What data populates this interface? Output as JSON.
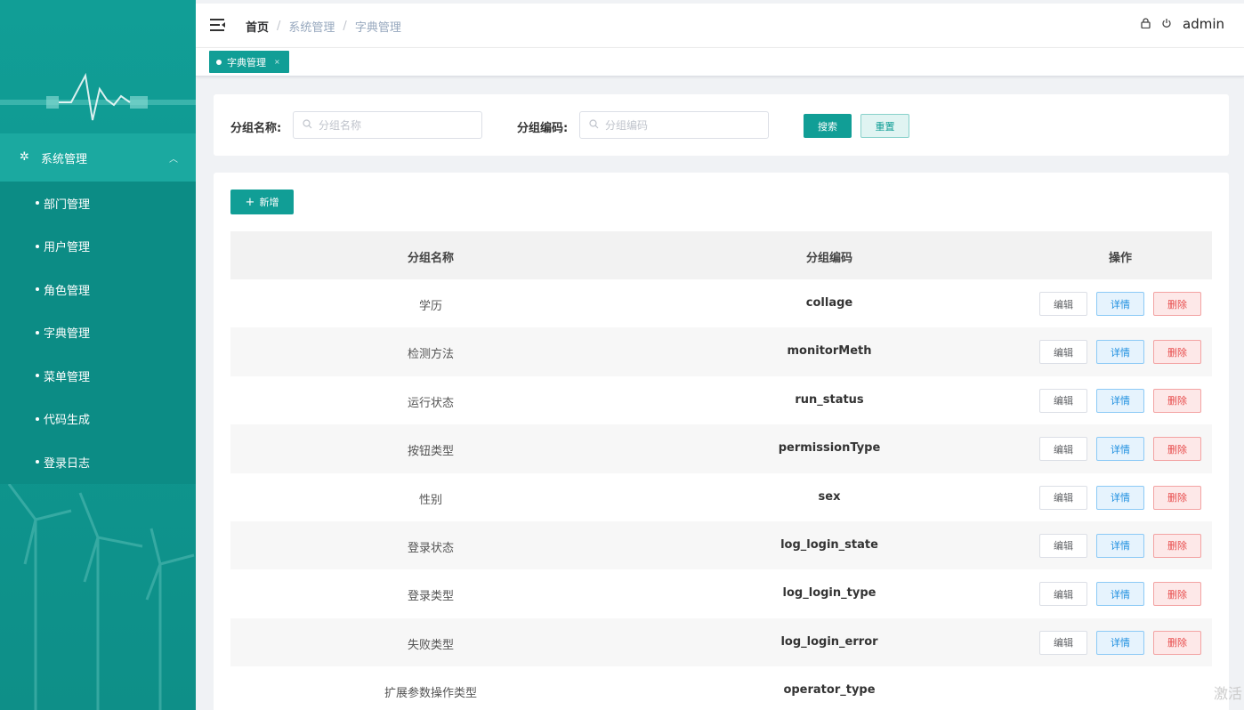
{
  "colors": {
    "primary": "#119e96",
    "sidebar_bg": "#0c8c85",
    "danger": "#e84d4d",
    "info": "#1d8fe0"
  },
  "sidebar": {
    "group": {
      "label": "系统管理",
      "icon": "gear-icon"
    },
    "items": [
      {
        "label": "部门管理"
      },
      {
        "label": "用户管理"
      },
      {
        "label": "角色管理"
      },
      {
        "label": "字典管理"
      },
      {
        "label": "菜单管理"
      },
      {
        "label": "代码生成"
      },
      {
        "label": "登录日志"
      }
    ]
  },
  "header": {
    "breadcrumbs": [
      "首页",
      "系统管理",
      "字典管理"
    ],
    "separator": "/",
    "user": "admin"
  },
  "tags": [
    {
      "label": "字典管理",
      "close": "×"
    }
  ],
  "search": {
    "group_name_label": "分组名称:",
    "group_name_placeholder": "分组名称",
    "group_code_label": "分组编码:",
    "group_code_placeholder": "分组编码",
    "search_button": "搜索",
    "reset_button": "重置"
  },
  "table": {
    "add_button": "新增",
    "columns": [
      "分组名称",
      "分组编码",
      "操作"
    ],
    "actions": {
      "edit": "编辑",
      "detail": "详情",
      "delete": "删除"
    },
    "rows": [
      {
        "name": "学历",
        "code": "collage"
      },
      {
        "name": "检测方法",
        "code": "monitorMeth"
      },
      {
        "name": "运行状态",
        "code": "run_status"
      },
      {
        "name": "按钮类型",
        "code": "permissionType"
      },
      {
        "name": "性别",
        "code": "sex"
      },
      {
        "name": "登录状态",
        "code": "log_login_state"
      },
      {
        "name": "登录类型",
        "code": "log_login_type"
      },
      {
        "name": "失败类型",
        "code": "log_login_error"
      },
      {
        "name": "扩展参数操作类型",
        "code": "operator_type"
      }
    ]
  },
  "watermark": "激活"
}
